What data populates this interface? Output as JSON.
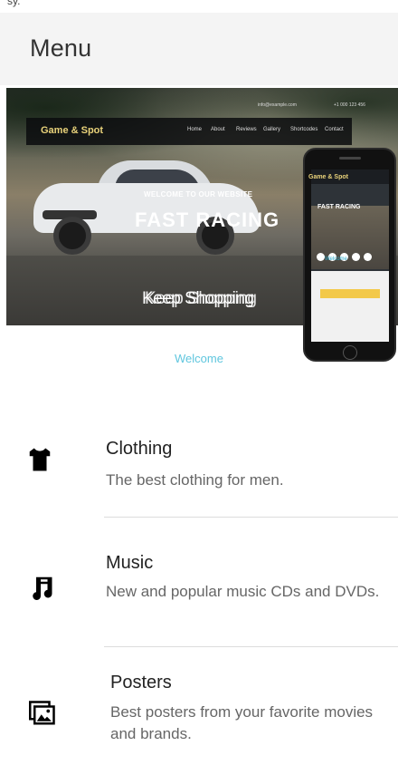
{
  "status_bar": {
    "text": "sy."
  },
  "app_bar": {
    "title": "Menu"
  },
  "banner": {
    "site_logo": "Game & Spot",
    "nav_links": [
      "Home",
      "About",
      "Reviews",
      "Gallery",
      "Shortcodes",
      "Contact"
    ],
    "top_email": "info@example.com",
    "top_phone": "+1 000 123 456",
    "welcome_small": "WELCOME TO OUR WEBSITE",
    "headline": "FAST RACING",
    "keep_shopping": "Keep Shopping",
    "phone_logo": "Game & Spot",
    "phone_headline": "FAST RACING",
    "phone_welcome": "Welcome",
    "welcome_below": "Welcome"
  },
  "menu": {
    "items": [
      {
        "icon": "tshirt-icon",
        "title": "Clothing",
        "description": "The best clothing for men."
      },
      {
        "icon": "music-note-icon",
        "title": "Music",
        "description": "New and popular music CDs and DVDs."
      },
      {
        "icon": "image-gallery-icon",
        "title": "Posters",
        "description": "Best posters from your favorite movies and brands."
      }
    ]
  }
}
